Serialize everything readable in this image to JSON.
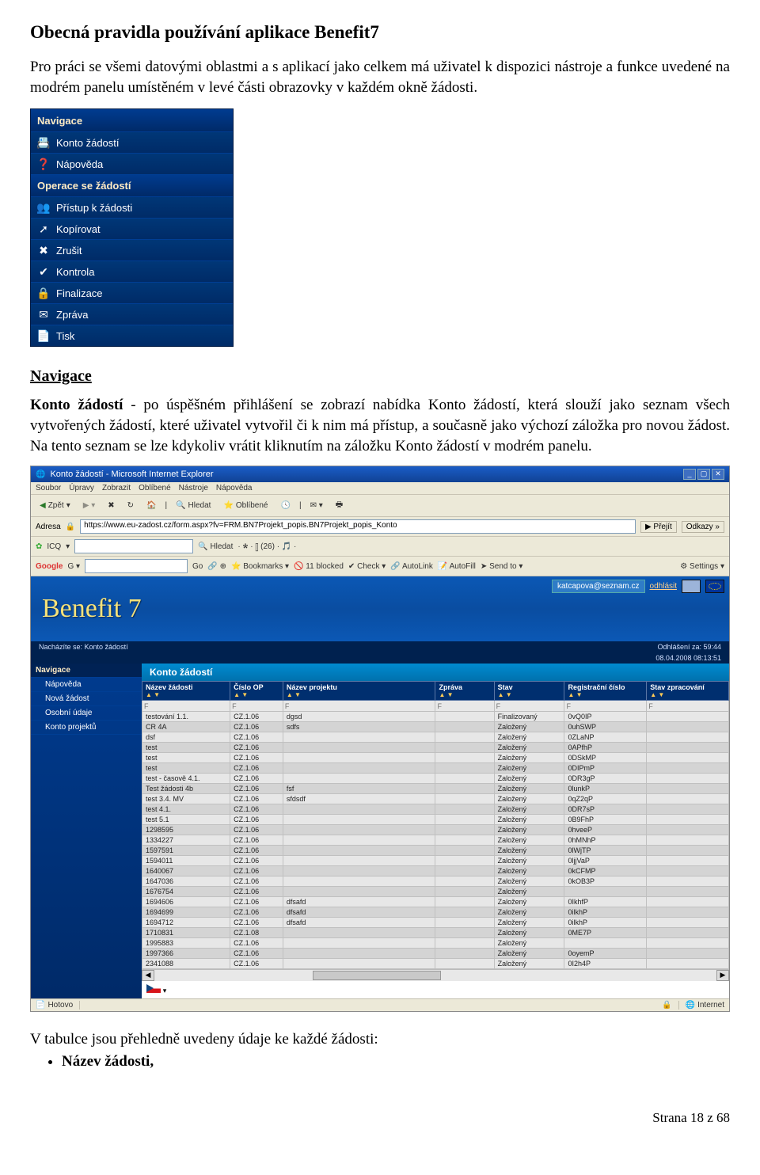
{
  "title": "Obecná pravidla používání aplikace Benefit7",
  "intro": "Pro práci se všemi datovými oblastmi a s aplikací jako celkem má uživatel k dispozici nástroje a funkce uvedené na modrém panelu umístěném v levé části obrazovky v každém okně žádosti.",
  "nav_panel": {
    "section1": "Navigace",
    "items1": [
      {
        "icon": "📇",
        "label": "Konto žádostí"
      },
      {
        "icon": "❓",
        "label": "Nápověda"
      }
    ],
    "section2": "Operace se žádostí",
    "items2": [
      {
        "icon": "👥",
        "label": "Přístup k žádosti"
      },
      {
        "icon": "➚",
        "label": "Kopírovat"
      },
      {
        "icon": "✖",
        "label": "Zrušit"
      },
      {
        "icon": "✔",
        "label": "Kontrola"
      },
      {
        "icon": "🔒",
        "label": "Finalizace"
      },
      {
        "icon": "✉",
        "label": "Zpráva"
      },
      {
        "icon": "📄",
        "label": "Tisk"
      }
    ]
  },
  "subheading": "Navigace",
  "konto_desc_strong": "Konto žádostí",
  "konto_desc_rest": " - po úspěšném přihlášení se zobrazí nabídka Konto žádostí, která slouží jako seznam všech vytvořených žádostí, které uživatel vytvořil či k nim má přístup, a současně jako výchozí záložka pro novou žádost. Na tento seznam se lze kdykoliv vrátit kliknutím na záložku Konto žádostí v modrém panelu.",
  "browser": {
    "window_title": "Konto žádostí - Microsoft Internet Explorer",
    "menu": [
      "Soubor",
      "Úpravy",
      "Zobrazit",
      "Oblíbené",
      "Nástroje",
      "Nápověda"
    ],
    "toolbar": {
      "back": "Zpět",
      "search": "Hledat",
      "favorites": "Oblíbené"
    },
    "address_label": "Adresa",
    "url": "https://www.eu-zadost.cz/form.aspx?fv=FRM.BN7Projekt_popis.BN7Projekt_popis_Konto",
    "go": "Přejít",
    "links": "Odkazy",
    "icq_bar": {
      "icq": "ICQ",
      "hledat": "Hledat"
    },
    "google_bar": {
      "g": "Google",
      "go": "Go",
      "bookmarks": "Bookmarks",
      "blocked": "11 blocked",
      "check": "Check",
      "autolink": "AutoLink",
      "autofill": "AutoFill",
      "sendto": "Send to",
      "settings": "Settings"
    },
    "brand": "Benefit 7",
    "user_email": "katcapova@seznam.cz",
    "logout": "odhlásit",
    "breadcrumb": "Nacházíte se: Konto žádostí",
    "countdown": "Odhlášení za: 59:44",
    "datetime": "08.04.2008  08:13:51",
    "left_nav_header": "Navigace",
    "left_nav": [
      "Nápověda",
      "Nová žádost",
      "Osobní údaje",
      "Konto projektů"
    ],
    "table_title": "Konto žádostí",
    "columns": [
      "Název žádosti",
      "Číslo OP",
      "Název projektu",
      "Zpráva",
      "Stav",
      "Registrační číslo",
      "Stav zpracování"
    ],
    "filter_placeholder": "F",
    "rows": [
      [
        "testování 1.1.",
        "CZ.1.06",
        "dgsd",
        "",
        "Finalizovaný",
        "0vQ0IP",
        ""
      ],
      [
        "CR 4A",
        "CZ.1.06",
        "sdfs",
        "",
        "Založený",
        "0uhSWP",
        ""
      ],
      [
        "dsf",
        "CZ.1.06",
        "",
        "",
        "Založený",
        "0ZLaNP",
        ""
      ],
      [
        "test",
        "CZ.1.06",
        "",
        "",
        "Založený",
        "0APfhP",
        ""
      ],
      [
        "test",
        "CZ.1.06",
        "",
        "",
        "Založený",
        "0DSkMP",
        ""
      ],
      [
        "test",
        "CZ.1.06",
        "",
        "",
        "Založený",
        "0DIPmP",
        ""
      ],
      [
        "test - časově 4.1.",
        "CZ.1.06",
        "",
        "",
        "Založený",
        "0DR3gP",
        ""
      ],
      [
        "Test žádosti 4b",
        "CZ.1.06",
        "fsf",
        "",
        "Založený",
        "0lunkP",
        ""
      ],
      [
        "test 3.4. MV",
        "CZ.1.06",
        "sfdsdf",
        "",
        "Založený",
        "0qZ2qP",
        ""
      ],
      [
        "test 4.1.",
        "CZ.1.06",
        "",
        "",
        "Založený",
        "0DR7sP",
        ""
      ],
      [
        "test 5.1",
        "CZ.1.06",
        "",
        "",
        "Založený",
        "0B9FhP",
        ""
      ],
      [
        "1298595",
        "CZ.1.06",
        "",
        "",
        "Založený",
        "0hveeP",
        ""
      ],
      [
        "1334227",
        "CZ.1.06",
        "",
        "",
        "Založený",
        "0hMNhP",
        ""
      ],
      [
        "1597591",
        "CZ.1.06",
        "",
        "",
        "Založený",
        "0lWjTP",
        ""
      ],
      [
        "1594011",
        "CZ.1.06",
        "",
        "",
        "Založený",
        "0ljjVaP",
        ""
      ],
      [
        "1640067",
        "CZ.1.06",
        "",
        "",
        "Založený",
        "0kCFMP",
        ""
      ],
      [
        "1647036",
        "CZ.1.06",
        "",
        "",
        "Založený",
        "0kOB3P",
        ""
      ],
      [
        "1676754",
        "CZ.1.06",
        "",
        "",
        "Založený",
        "",
        ""
      ],
      [
        "1694606",
        "CZ.1.06",
        "dfsafd",
        "",
        "Založený",
        "0IkhfP",
        ""
      ],
      [
        "1694699",
        "CZ.1.06",
        "dfsafd",
        "",
        "Založený",
        "0ilkhP",
        ""
      ],
      [
        "1694712",
        "CZ.1.06",
        "dfsafd",
        "",
        "Založený",
        "0ilkhP",
        ""
      ],
      [
        "1710831",
        "CZ.1.08",
        "",
        "",
        "Založený",
        "0ME7P",
        ""
      ],
      [
        "1995883",
        "CZ.1.06",
        "",
        "",
        "Založený",
        "",
        ""
      ],
      [
        "1997366",
        "CZ.1.06",
        "",
        "",
        "Založený",
        "0oyemP",
        ""
      ],
      [
        "2341088",
        "CZ.1.06",
        "",
        "",
        "Založený",
        "0I2h4P",
        ""
      ]
    ],
    "status_done": "Hotovo",
    "status_internet": "Internet"
  },
  "tail_text": "V tabulce jsou přehledně uvedeny údaje ke každé žádosti:",
  "bullets": [
    "Název žádosti,"
  ],
  "page_num": "Strana 18 z 68"
}
